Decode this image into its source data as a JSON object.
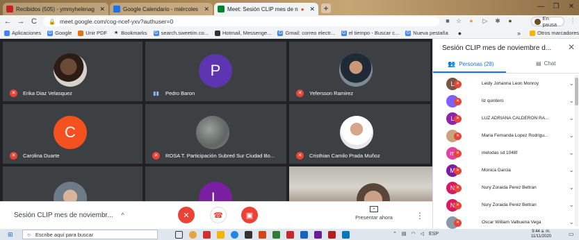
{
  "browser": {
    "tabs": [
      {
        "label": "Recibidos (505) - ymmyhelenag",
        "close": "✕",
        "color": "#c5221f"
      },
      {
        "label": "Google Calendario - miércoles",
        "close": "✕",
        "color": "#1a73e8"
      },
      {
        "label": "Meet: Sesión CLIP mes de n",
        "close": "✕",
        "color": "#00832d"
      }
    ],
    "new_tab": "+",
    "window_controls": {
      "minimize": "—",
      "maximize": "❐",
      "close": "✕"
    },
    "url": "meet.google.com/cog-ncef-yxv?authuser=0",
    "profile_label": "En pausa",
    "bookmarks": [
      {
        "label": "Aplicaciones",
        "icon": "apps-icon",
        "color": "#4285f4"
      },
      {
        "label": "Google",
        "icon": "google-icon",
        "color": "#4285f4"
      },
      {
        "label": "Unir PDF",
        "icon": "pdf-icon",
        "color": "#e8710a"
      },
      {
        "label": "Bookmarks",
        "icon": "star-icon",
        "color": "#333333"
      },
      {
        "label": "search.sweetim.co...",
        "icon": "google-icon",
        "color": "#4285f4"
      },
      {
        "label": "Hotmail, Messenge...",
        "icon": "msn-icon",
        "color": "#333333"
      },
      {
        "label": "Gmail: correo electr...",
        "icon": "google-icon",
        "color": "#4285f4"
      },
      {
        "label": "el tiempo - Buscar c...",
        "icon": "google-icon",
        "color": "#4285f4"
      },
      {
        "label": "Nueva pestaña",
        "icon": "google-icon",
        "color": "#4285f4"
      }
    ],
    "bookmarks_overflow": "»",
    "other_bookmarks": "Otros marcadores"
  },
  "meeting": {
    "tiles": [
      {
        "name": "Erika Diaz Velasquez",
        "avatar": "photo",
        "mic": "off",
        "initial": ""
      },
      {
        "name": "Pedro Baron",
        "avatar": "letter",
        "mic": "speaking",
        "initial": "P"
      },
      {
        "name": "Yefersson Ramirez",
        "avatar": "photo",
        "mic": "off",
        "initial": ""
      },
      {
        "name": "Carolina Duarte",
        "avatar": "letter",
        "mic": "off",
        "initial": "C"
      },
      {
        "name": "ROSA T. Participación Subred Sur Ciudad Bo...",
        "avatar": "photo",
        "mic": "off",
        "initial": ""
      },
      {
        "name": "Cristhian Camilo Prada Muñoz",
        "avatar": "photo",
        "mic": "off",
        "initial": ""
      }
    ],
    "partial_tile_initial": "L",
    "title": "Sesión CLIP mes de noviembr...",
    "title_chevron": "^",
    "present_label": "Presentar ahora",
    "more_icon": "⋮"
  },
  "panel": {
    "title": "Sesión CLIP mes de noviembre d...",
    "close": "✕",
    "tab_people": "Personas (28)",
    "tab_chat": "Chat",
    "people": [
      {
        "name": "Leidy Johanna Leon Monroy",
        "initial": "L",
        "color": "#795548"
      },
      {
        "name": "liz quintero",
        "initial": "",
        "color": "#7b61ff"
      },
      {
        "name": "LUZ ADRIANA CALDERON RA...",
        "initial": "L",
        "color": "#8e24aa"
      },
      {
        "name": "Maria Fernanda Lopez Rodrigu...",
        "initial": "",
        "color": "#c9a27e"
      },
      {
        "name": "melodas sd 1048f",
        "initial": "m",
        "color": "#e040a0"
      },
      {
        "name": "Monica Garcia",
        "initial": "M",
        "color": "#7b1fa2"
      },
      {
        "name": "Nury Zoraida Perez Beltran",
        "initial": "N",
        "color": "#d81b60"
      },
      {
        "name": "Nury Zoraida Perez Beltran",
        "initial": "N",
        "color": "#d81b60"
      },
      {
        "name": "Oscar William Valbuena Vega",
        "initial": "",
        "color": "#8a9aa5"
      }
    ]
  },
  "taskbar": {
    "search_placeholder": "Escribe aquí para buscar",
    "language": "ESP",
    "time": "9:44 a. m.",
    "date": "11/11/2020"
  }
}
